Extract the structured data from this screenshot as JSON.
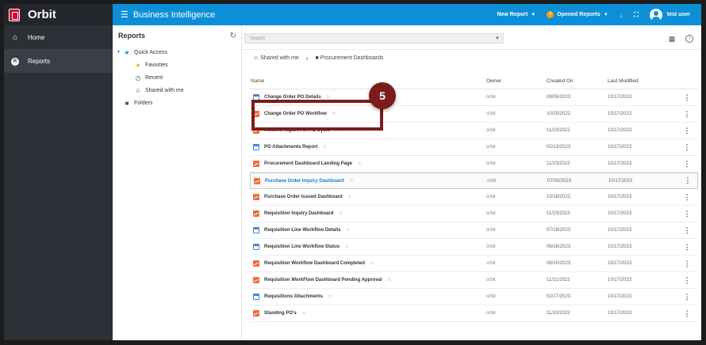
{
  "app": {
    "name": "Orbit",
    "module_title": "Business Intelligence"
  },
  "leftnav": {
    "items": [
      {
        "label": "Home",
        "icon": "home-icon"
      },
      {
        "label": "Reports",
        "icon": "reports-icon",
        "badge": "R"
      }
    ]
  },
  "topbar": {
    "new_report_label": "New Report",
    "opened_reports_label": "Opened Reports",
    "opened_reports_count": "2",
    "user_name": "test user"
  },
  "sidebar": {
    "title": "Reports",
    "quick_access_label": "Quick Access",
    "quick_access_items": [
      "Favorites",
      "Recent",
      "Shared with me"
    ],
    "folders_label": "Folders"
  },
  "main": {
    "search_placeholder": "Search",
    "breadcrumb": [
      "Shared with me",
      "Procurement Dashboards"
    ]
  },
  "table": {
    "headers": {
      "name": "Name",
      "owner": "Owner",
      "created": "Created On",
      "modified": "Last Modified"
    },
    "rows": [
      {
        "name": "Change Order PO Details",
        "type": "doc",
        "owner": "orbit",
        "created": "09/05/2023",
        "modified": "10/17/2023"
      },
      {
        "name": "Change Order PO Workflow",
        "type": "chart",
        "owner": "orbit",
        "created": "10/20/2022",
        "modified": "10/17/2023"
      },
      {
        "name": "Historic Report For PO Cycle",
        "type": "chart",
        "owner": "orbit",
        "created": "11/23/2022",
        "modified": "10/17/2023"
      },
      {
        "name": "PO Attachments Report",
        "type": "doc",
        "owner": "orbit",
        "created": "02/13/2023",
        "modified": "10/17/2023"
      },
      {
        "name": "Procurement Dashboard Landing Page",
        "type": "chart",
        "owner": "orbit",
        "created": "11/23/2022",
        "modified": "10/17/2023"
      },
      {
        "name": "Purchase Order Inquiry Dashboard",
        "type": "chart",
        "owner": "orbit",
        "created": "07/30/2023",
        "modified": "10/17/2023"
      },
      {
        "name": "Purchase Order Issued Dashboard",
        "type": "chart",
        "owner": "orbit",
        "created": "10/18/2022",
        "modified": "10/17/2023"
      },
      {
        "name": "Requisition Inquiry Dashboard",
        "type": "chart",
        "owner": "orbit",
        "created": "11/23/2022",
        "modified": "10/17/2023"
      },
      {
        "name": "Requisition Line Workflow Details",
        "type": "doc",
        "owner": "orbit",
        "created": "07/18/2023",
        "modified": "10/17/2023"
      },
      {
        "name": "Requisition Line Workflow Status",
        "type": "doc",
        "owner": "orbit",
        "created": "06/26/2023",
        "modified": "10/17/2023"
      },
      {
        "name": "Requisition Workflow Dashboard Completed",
        "type": "chart",
        "owner": "orbit",
        "created": "08/10/2023",
        "modified": "10/17/2023"
      },
      {
        "name": "Requisition WorkFlow Dashboard Pending Approval",
        "type": "chart",
        "owner": "orbit",
        "created": "11/21/2022",
        "modified": "10/17/2023"
      },
      {
        "name": "Requisitions Attachments",
        "type": "doc",
        "owner": "orbit",
        "created": "02/17/2023",
        "modified": "10/17/2023"
      },
      {
        "name": "Standing PO's",
        "type": "chart",
        "owner": "orbit",
        "created": "11/10/2022",
        "modified": "10/17/2023"
      }
    ]
  },
  "callout": {
    "number": "5"
  },
  "colors": {
    "topbar": "#0c8fd6",
    "nav": "#2c2f36",
    "callout": "#7b1c1c",
    "link": "#1c7fc8"
  }
}
